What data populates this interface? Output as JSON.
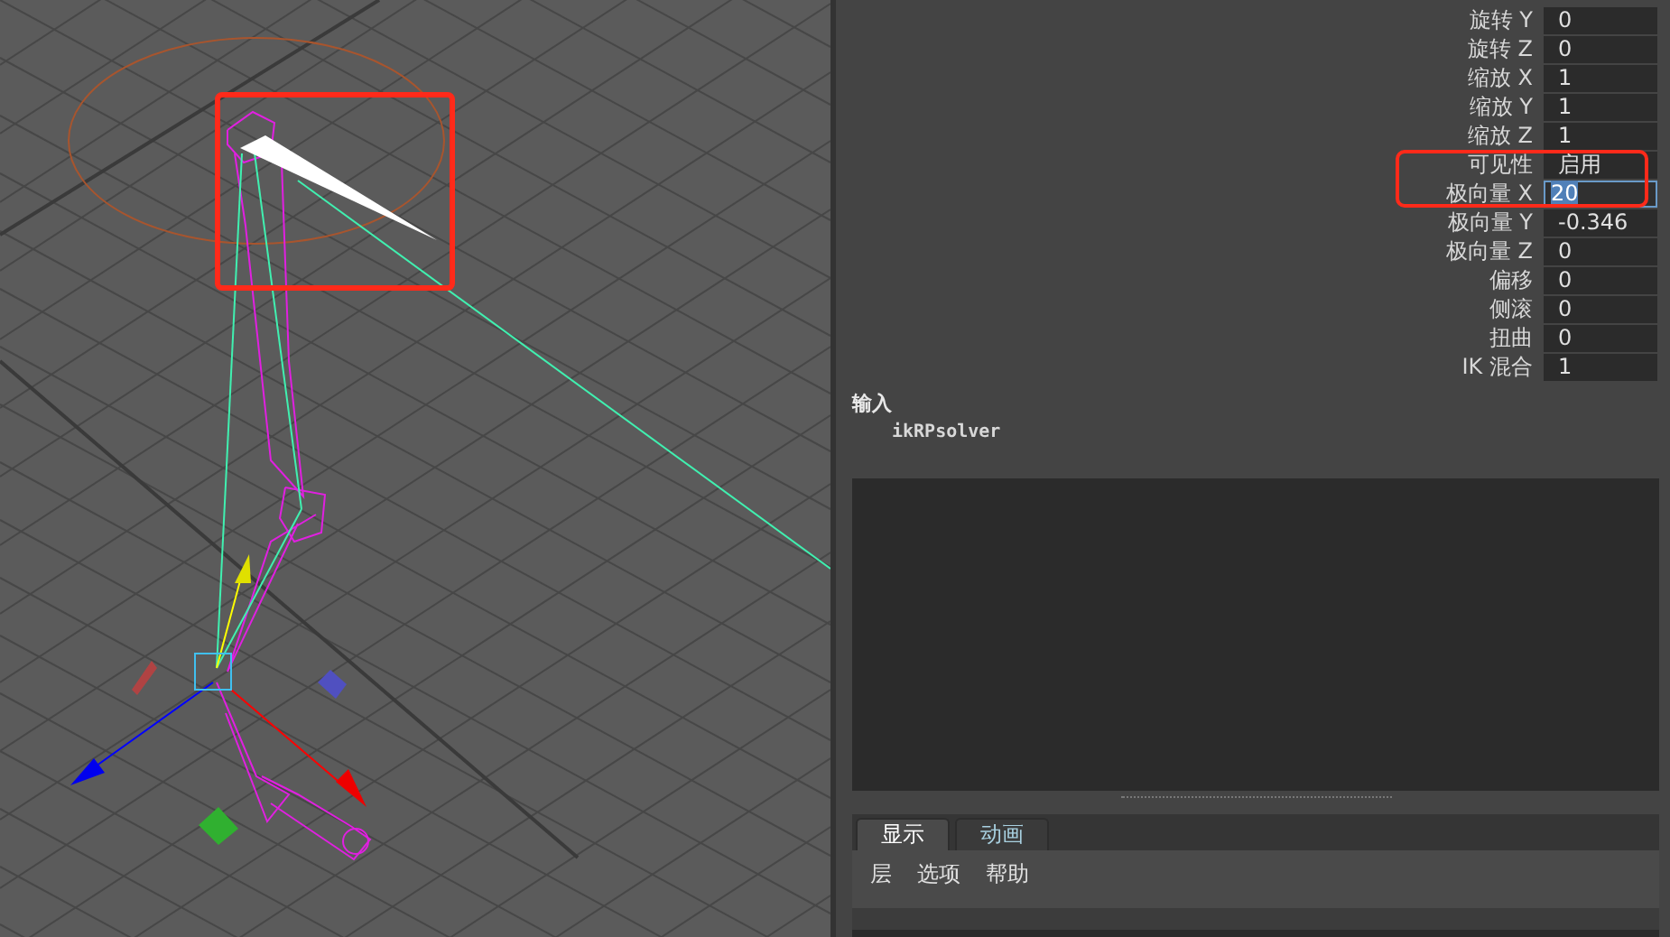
{
  "attributes": [
    {
      "label": "旋转 Y",
      "value": "0",
      "focused": false
    },
    {
      "label": "旋转 Z",
      "value": "0",
      "focused": false
    },
    {
      "label": "缩放 X",
      "value": "1",
      "focused": false
    },
    {
      "label": "缩放 Y",
      "value": "1",
      "focused": false
    },
    {
      "label": "缩放 Z",
      "value": "1",
      "focused": false
    },
    {
      "label": "可见性",
      "value": "启用",
      "focused": false
    },
    {
      "label": "极向量 X",
      "value": "20",
      "focused": true
    },
    {
      "label": "极向量 Y",
      "value": "-0.346",
      "focused": false
    },
    {
      "label": "极向量 Z",
      "value": "0",
      "focused": false
    },
    {
      "label": "偏移",
      "value": "0",
      "focused": false
    },
    {
      "label": "侧滚",
      "value": "0",
      "focused": false
    },
    {
      "label": "扭曲",
      "value": "0",
      "focused": false
    },
    {
      "label": "IK 混合",
      "value": "1",
      "focused": false
    }
  ],
  "inputs": {
    "heading": "输入",
    "items": [
      "ikRPsolver"
    ]
  },
  "tabs": [
    {
      "label": "显示",
      "selected": true
    },
    {
      "label": "动画",
      "selected": false
    }
  ],
  "menu": [
    "层",
    "选项",
    "帮助"
  ]
}
